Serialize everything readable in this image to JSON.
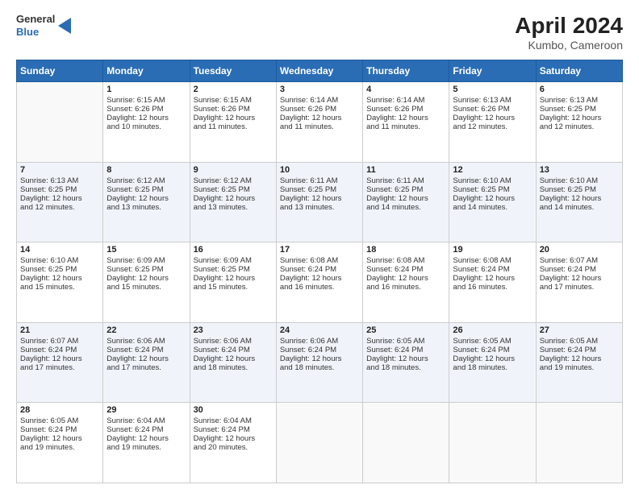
{
  "header": {
    "logo_line1": "General",
    "logo_line2": "Blue",
    "title": "April 2024",
    "subtitle": "Kumbo, Cameroon"
  },
  "days_of_week": [
    "Sunday",
    "Monday",
    "Tuesday",
    "Wednesday",
    "Thursday",
    "Friday",
    "Saturday"
  ],
  "weeks": [
    [
      {
        "day": "",
        "info": ""
      },
      {
        "day": "1",
        "info": "Sunrise: 6:15 AM\nSunset: 6:26 PM\nDaylight: 12 hours\nand 10 minutes."
      },
      {
        "day": "2",
        "info": "Sunrise: 6:15 AM\nSunset: 6:26 PM\nDaylight: 12 hours\nand 11 minutes."
      },
      {
        "day": "3",
        "info": "Sunrise: 6:14 AM\nSunset: 6:26 PM\nDaylight: 12 hours\nand 11 minutes."
      },
      {
        "day": "4",
        "info": "Sunrise: 6:14 AM\nSunset: 6:26 PM\nDaylight: 12 hours\nand 11 minutes."
      },
      {
        "day": "5",
        "info": "Sunrise: 6:13 AM\nSunset: 6:26 PM\nDaylight: 12 hours\nand 12 minutes."
      },
      {
        "day": "6",
        "info": "Sunrise: 6:13 AM\nSunset: 6:25 PM\nDaylight: 12 hours\nand 12 minutes."
      }
    ],
    [
      {
        "day": "7",
        "info": "Sunrise: 6:13 AM\nSunset: 6:25 PM\nDaylight: 12 hours\nand 12 minutes."
      },
      {
        "day": "8",
        "info": "Sunrise: 6:12 AM\nSunset: 6:25 PM\nDaylight: 12 hours\nand 13 minutes."
      },
      {
        "day": "9",
        "info": "Sunrise: 6:12 AM\nSunset: 6:25 PM\nDaylight: 12 hours\nand 13 minutes."
      },
      {
        "day": "10",
        "info": "Sunrise: 6:11 AM\nSunset: 6:25 PM\nDaylight: 12 hours\nand 13 minutes."
      },
      {
        "day": "11",
        "info": "Sunrise: 6:11 AM\nSunset: 6:25 PM\nDaylight: 12 hours\nand 14 minutes."
      },
      {
        "day": "12",
        "info": "Sunrise: 6:10 AM\nSunset: 6:25 PM\nDaylight: 12 hours\nand 14 minutes."
      },
      {
        "day": "13",
        "info": "Sunrise: 6:10 AM\nSunset: 6:25 PM\nDaylight: 12 hours\nand 14 minutes."
      }
    ],
    [
      {
        "day": "14",
        "info": "Sunrise: 6:10 AM\nSunset: 6:25 PM\nDaylight: 12 hours\nand 15 minutes."
      },
      {
        "day": "15",
        "info": "Sunrise: 6:09 AM\nSunset: 6:25 PM\nDaylight: 12 hours\nand 15 minutes."
      },
      {
        "day": "16",
        "info": "Sunrise: 6:09 AM\nSunset: 6:25 PM\nDaylight: 12 hours\nand 15 minutes."
      },
      {
        "day": "17",
        "info": "Sunrise: 6:08 AM\nSunset: 6:24 PM\nDaylight: 12 hours\nand 16 minutes."
      },
      {
        "day": "18",
        "info": "Sunrise: 6:08 AM\nSunset: 6:24 PM\nDaylight: 12 hours\nand 16 minutes."
      },
      {
        "day": "19",
        "info": "Sunrise: 6:08 AM\nSunset: 6:24 PM\nDaylight: 12 hours\nand 16 minutes."
      },
      {
        "day": "20",
        "info": "Sunrise: 6:07 AM\nSunset: 6:24 PM\nDaylight: 12 hours\nand 17 minutes."
      }
    ],
    [
      {
        "day": "21",
        "info": "Sunrise: 6:07 AM\nSunset: 6:24 PM\nDaylight: 12 hours\nand 17 minutes."
      },
      {
        "day": "22",
        "info": "Sunrise: 6:06 AM\nSunset: 6:24 PM\nDaylight: 12 hours\nand 17 minutes."
      },
      {
        "day": "23",
        "info": "Sunrise: 6:06 AM\nSunset: 6:24 PM\nDaylight: 12 hours\nand 18 minutes."
      },
      {
        "day": "24",
        "info": "Sunrise: 6:06 AM\nSunset: 6:24 PM\nDaylight: 12 hours\nand 18 minutes."
      },
      {
        "day": "25",
        "info": "Sunrise: 6:05 AM\nSunset: 6:24 PM\nDaylight: 12 hours\nand 18 minutes."
      },
      {
        "day": "26",
        "info": "Sunrise: 6:05 AM\nSunset: 6:24 PM\nDaylight: 12 hours\nand 18 minutes."
      },
      {
        "day": "27",
        "info": "Sunrise: 6:05 AM\nSunset: 6:24 PM\nDaylight: 12 hours\nand 19 minutes."
      }
    ],
    [
      {
        "day": "28",
        "info": "Sunrise: 6:05 AM\nSunset: 6:24 PM\nDaylight: 12 hours\nand 19 minutes."
      },
      {
        "day": "29",
        "info": "Sunrise: 6:04 AM\nSunset: 6:24 PM\nDaylight: 12 hours\nand 19 minutes."
      },
      {
        "day": "30",
        "info": "Sunrise: 6:04 AM\nSunset: 6:24 PM\nDaylight: 12 hours\nand 20 minutes."
      },
      {
        "day": "",
        "info": ""
      },
      {
        "day": "",
        "info": ""
      },
      {
        "day": "",
        "info": ""
      },
      {
        "day": "",
        "info": ""
      }
    ]
  ]
}
